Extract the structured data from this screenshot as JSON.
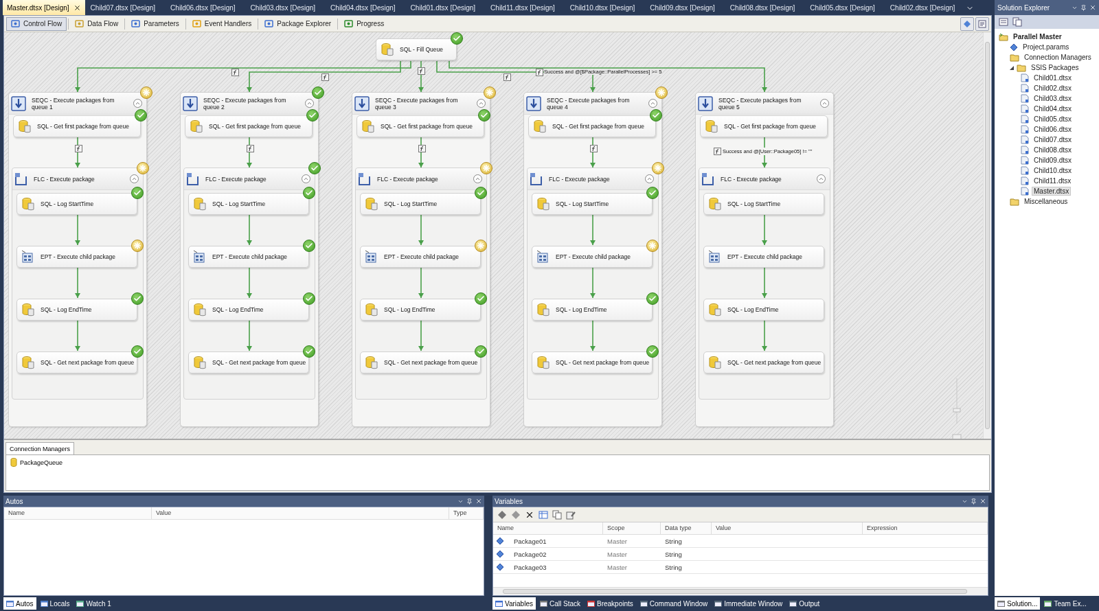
{
  "doc_tabs": [
    {
      "label": "Master.dtsx [Design]",
      "selected": true
    },
    {
      "label": "Child07.dtsx [Design]",
      "selected": false
    },
    {
      "label": "Child06.dtsx [Design]",
      "selected": false
    },
    {
      "label": "Child03.dtsx [Design]",
      "selected": false
    },
    {
      "label": "Child04.dtsx [Design]",
      "selected": false
    },
    {
      "label": "Child01.dtsx [Design]",
      "selected": false
    },
    {
      "label": "Child11.dtsx [Design]",
      "selected": false
    },
    {
      "label": "Child10.dtsx [Design]",
      "selected": false
    },
    {
      "label": "Child09.dtsx [Design]",
      "selected": false
    },
    {
      "label": "Child08.dtsx [Design]",
      "selected": false
    },
    {
      "label": "Child05.dtsx [Design]",
      "selected": false
    },
    {
      "label": "Child02.dtsx [Design]",
      "selected": false
    }
  ],
  "designer_tabs": [
    {
      "label": "Control Flow",
      "kind": "flow",
      "selected": true
    },
    {
      "label": "Data Flow",
      "kind": "data",
      "selected": false
    },
    {
      "label": "Parameters",
      "kind": "params",
      "selected": false
    },
    {
      "label": "Event Handlers",
      "kind": "events",
      "selected": false
    },
    {
      "label": "Package Explorer",
      "kind": "explorer",
      "selected": false
    },
    {
      "label": "Progress",
      "kind": "progress",
      "selected": false
    }
  ],
  "canvas": {
    "start_task": {
      "kind": "sql",
      "name": "SQL - Fill Queue",
      "succeeded": true,
      "running": false
    },
    "start_link_label": "Success and @[$Package::ParallelProcesses] >= 5",
    "containers": [
      {
        "title": "SEQC - Execute packages from queue 1",
        "succeeded": false,
        "running": true,
        "first_task": {
          "kind": "sql",
          "name": "SQL - Get first package from queue",
          "succeeded": true,
          "running": false
        },
        "loop": {
          "title": "FLC - Execute package",
          "succeeded": false,
          "running": true,
          "tasks": [
            {
              "kind": "sql",
              "name": "SQL - Log StartTime",
              "succeeded": true,
              "running": false
            },
            {
              "kind": "package",
              "name": "EPT - Execute child package",
              "succeeded": false,
              "running": true
            },
            {
              "kind": "sql",
              "name": "SQL - Log EndTime",
              "succeeded": true,
              "running": false
            },
            {
              "kind": "sql",
              "name": "SQL - Get next package from queue",
              "succeeded": true,
              "running": false
            }
          ]
        }
      },
      {
        "title": "SEQC - Execute packages from queue 2",
        "succeeded": true,
        "running": false,
        "first_task": {
          "kind": "sql",
          "name": "SQL - Get first package from queue",
          "succeeded": true,
          "running": false
        },
        "loop": {
          "title": "FLC - Execute package",
          "succeeded": true,
          "running": false,
          "tasks": [
            {
              "kind": "sql",
              "name": "SQL - Log StartTime",
              "succeeded": true,
              "running": false
            },
            {
              "kind": "package",
              "name": "EPT - Execute child package",
              "succeeded": true,
              "running": false
            },
            {
              "kind": "sql",
              "name": "SQL - Log EndTime",
              "succeeded": true,
              "running": false
            },
            {
              "kind": "sql",
              "name": "SQL - Get next package from queue",
              "succeeded": true,
              "running": false
            }
          ]
        }
      },
      {
        "title": "SEQC - Execute packages from queue 3",
        "succeeded": false,
        "running": true,
        "first_task": {
          "kind": "sql",
          "name": "SQL - Get first package from queue",
          "succeeded": true,
          "running": false
        },
        "loop": {
          "title": "FLC - Execute package",
          "succeeded": false,
          "running": true,
          "tasks": [
            {
              "kind": "sql",
              "name": "SQL - Log StartTime",
              "succeeded": true,
              "running": false
            },
            {
              "kind": "package",
              "name": "EPT - Execute child package",
              "succeeded": false,
              "running": true
            },
            {
              "kind": "sql",
              "name": "SQL - Log EndTime",
              "succeeded": true,
              "running": false
            },
            {
              "kind": "sql",
              "name": "SQL - Get next package from queue",
              "succeeded": true,
              "running": false
            }
          ]
        }
      },
      {
        "title": "SEQC - Execute packages from queue 4",
        "succeeded": false,
        "running": true,
        "first_task": {
          "kind": "sql",
          "name": "SQL - Get first package from queue",
          "succeeded": true,
          "running": false
        },
        "loop": {
          "title": "FLC - Execute package",
          "succeeded": false,
          "running": true,
          "tasks": [
            {
              "kind": "sql",
              "name": "SQL - Log StartTime",
              "succeeded": true,
              "running": false
            },
            {
              "kind": "package",
              "name": "EPT - Execute child package",
              "succeeded": false,
              "running": true
            },
            {
              "kind": "sql",
              "name": "SQL - Log EndTime",
              "succeeded": true,
              "running": false
            },
            {
              "kind": "sql",
              "name": "SQL - Get next package from queue",
              "succeeded": true,
              "running": false
            }
          ]
        }
      },
      {
        "title": "SEQC - Execute packages from queue 5",
        "succeeded": false,
        "running": false,
        "first_task": {
          "kind": "sql",
          "name": "SQL - Get first package from queue",
          "succeeded": false,
          "running": false
        },
        "link_label": "Success and @[User::Package05] != \"\"",
        "loop": {
          "title": "FLC - Execute package",
          "succeeded": false,
          "running": false,
          "tasks": [
            {
              "kind": "sql",
              "name": "SQL - Log StartTime",
              "succeeded": false,
              "running": false
            },
            {
              "kind": "package",
              "name": "EPT - Execute child package",
              "succeeded": false,
              "running": false
            },
            {
              "kind": "sql",
              "name": "SQL - Log EndTime",
              "succeeded": false,
              "running": false
            },
            {
              "kind": "sql",
              "name": "SQL - Get next package from queue",
              "succeeded": false,
              "running": false
            }
          ]
        }
      }
    ]
  },
  "connection_managers": {
    "tab": "Connection Managers",
    "items": [
      "PackageQueue"
    ]
  },
  "autos": {
    "title": "Autos",
    "columns": [
      "Name",
      "Value",
      "Type"
    ],
    "tabs": [
      {
        "label": "Autos",
        "kind": "autos",
        "selected": true
      },
      {
        "label": "Locals",
        "kind": "locals",
        "selected": false
      },
      {
        "label": "Watch 1",
        "kind": "watch",
        "selected": false
      }
    ]
  },
  "variables": {
    "title": "Variables",
    "columns": [
      "Name",
      "Scope",
      "Data type",
      "Value",
      "Expression"
    ],
    "rows": [
      {
        "name": "Package01",
        "scope": "Master",
        "data_type": "String"
      },
      {
        "name": "Package02",
        "scope": "Master",
        "data_type": "String"
      },
      {
        "name": "Package03",
        "scope": "Master",
        "data_type": "String"
      }
    ],
    "tabs": [
      {
        "label": "Variables",
        "kind": "variables",
        "selected": true
      },
      {
        "label": "Call Stack",
        "kind": "stack",
        "selected": false
      },
      {
        "label": "Breakpoints",
        "kind": "breakpoints",
        "selected": false
      },
      {
        "label": "Command Window",
        "kind": "command",
        "selected": false
      },
      {
        "label": "Immediate Window",
        "kind": "immediate",
        "selected": false
      },
      {
        "label": "Output",
        "kind": "output",
        "selected": false
      }
    ]
  },
  "solution_explorer": {
    "title": "Solution Explorer",
    "tree": [
      {
        "label": "Parallel Master",
        "kind": "project",
        "selected": false,
        "children": [
          {
            "label": "Project.params",
            "kind": "params",
            "selected": false
          },
          {
            "label": "Connection Managers",
            "kind": "folder",
            "selected": false
          },
          {
            "label": "SSIS Packages",
            "kind": "folder",
            "expanded": true,
            "selected": false,
            "children": [
              {
                "label": "Child01.dtsx",
                "kind": "package",
                "selected": false
              },
              {
                "label": "Child02.dtsx",
                "kind": "package",
                "selected": false
              },
              {
                "label": "Child03.dtsx",
                "kind": "package",
                "selected": false
              },
              {
                "label": "Child04.dtsx",
                "kind": "package",
                "selected": false
              },
              {
                "label": "Child05.dtsx",
                "kind": "package",
                "selected": false
              },
              {
                "label": "Child06.dtsx",
                "kind": "package",
                "selected": false
              },
              {
                "label": "Child07.dtsx",
                "kind": "package",
                "selected": false
              },
              {
                "label": "Child08.dtsx",
                "kind": "package",
                "selected": false
              },
              {
                "label": "Child09.dtsx",
                "kind": "package",
                "selected": false
              },
              {
                "label": "Child10.dtsx",
                "kind": "package",
                "selected": false
              },
              {
                "label": "Child11.dtsx",
                "kind": "package",
                "selected": false
              },
              {
                "label": "Master.dtsx",
                "kind": "package",
                "selected": true
              }
            ]
          },
          {
            "label": "Miscellaneous",
            "kind": "folder",
            "selected": false
          }
        ]
      }
    ],
    "tabs": [
      {
        "label": "Solution...",
        "kind": "solution",
        "selected": true
      },
      {
        "label": "Team Ex...",
        "kind": "team",
        "selected": false
      }
    ]
  }
}
